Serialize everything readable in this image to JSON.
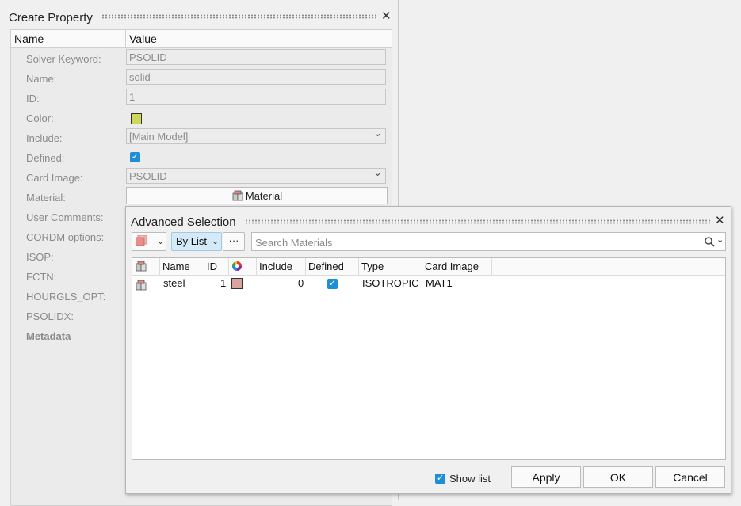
{
  "create_property": {
    "title": "Create Property",
    "columns": {
      "name": "Name",
      "value": "Value"
    },
    "rows": [
      {
        "label": "Solver Keyword:",
        "value": "PSOLID"
      },
      {
        "label": "Name:",
        "value": "solid"
      },
      {
        "label": "ID:",
        "value": "1"
      },
      {
        "label": "Color:",
        "color": "#cfd75a"
      },
      {
        "label": "Include:",
        "value": "[Main Model]"
      },
      {
        "label": "Defined:",
        "checked": true
      },
      {
        "label": "Card Image:",
        "value": "PSOLID"
      },
      {
        "label": "Material:",
        "button": "Material"
      },
      {
        "label": "User Comments:"
      },
      {
        "label": "CORDM options:"
      },
      {
        "label": "ISOP:"
      },
      {
        "label": "FCTN:"
      },
      {
        "label": "HOURGLS_OPT:"
      },
      {
        "label": "PSOLIDX:"
      },
      {
        "label": "Metadata"
      }
    ]
  },
  "advanced_selection": {
    "title": "Advanced Selection",
    "mode": "By List",
    "more": "···",
    "search_placeholder": "Search Materials",
    "columns": [
      "Name",
      "ID",
      "Include",
      "Defined",
      "Type",
      "Card Image"
    ],
    "rows": [
      {
        "name": "steel",
        "id": "1",
        "color": "#d9a39e",
        "include": "0",
        "defined": true,
        "type": "ISOTROPIC",
        "card_image": "MAT1"
      }
    ],
    "show_list_label": "Show list",
    "show_list_checked": true,
    "buttons": {
      "apply": "Apply",
      "ok": "OK",
      "cancel": "Cancel"
    }
  },
  "icons": {
    "close": "close-icon",
    "material": "material-icon",
    "search": "search-icon",
    "color_wheel": "color-wheel-icon",
    "entity": "entity-selector-icon"
  },
  "colors": {
    "accent": "#1e8fd6",
    "selection_mode_bg": "#d4eaf8",
    "entity_swatch": "#e88d89"
  }
}
